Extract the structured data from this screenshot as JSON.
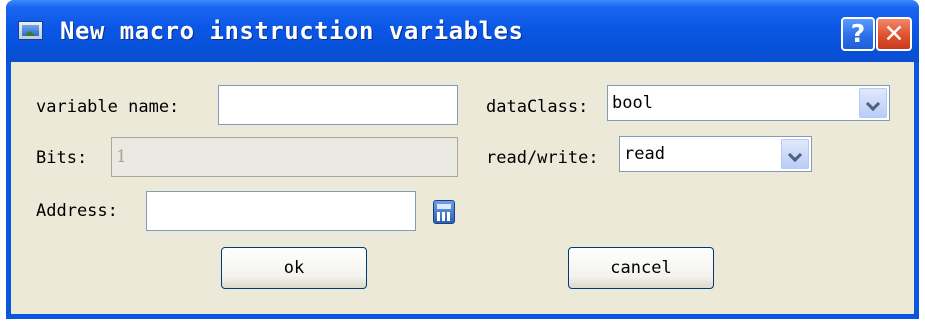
{
  "window": {
    "title": "New macro instruction variables",
    "help_label": "?",
    "close_label": "✕"
  },
  "form": {
    "variable_name": {
      "label": "variable name:",
      "value": ""
    },
    "data_class": {
      "label": "dataClass:",
      "value": "bool"
    },
    "bits": {
      "label": "Bits:",
      "value": "1",
      "disabled": true
    },
    "read_write": {
      "label": "read/write:",
      "value": "read"
    },
    "address": {
      "label": "Address:",
      "value": ""
    }
  },
  "buttons": {
    "ok": "ok",
    "cancel": "cancel"
  },
  "icons": {
    "title_icon": "window-app-icon",
    "calculator": "calculator-icon"
  }
}
